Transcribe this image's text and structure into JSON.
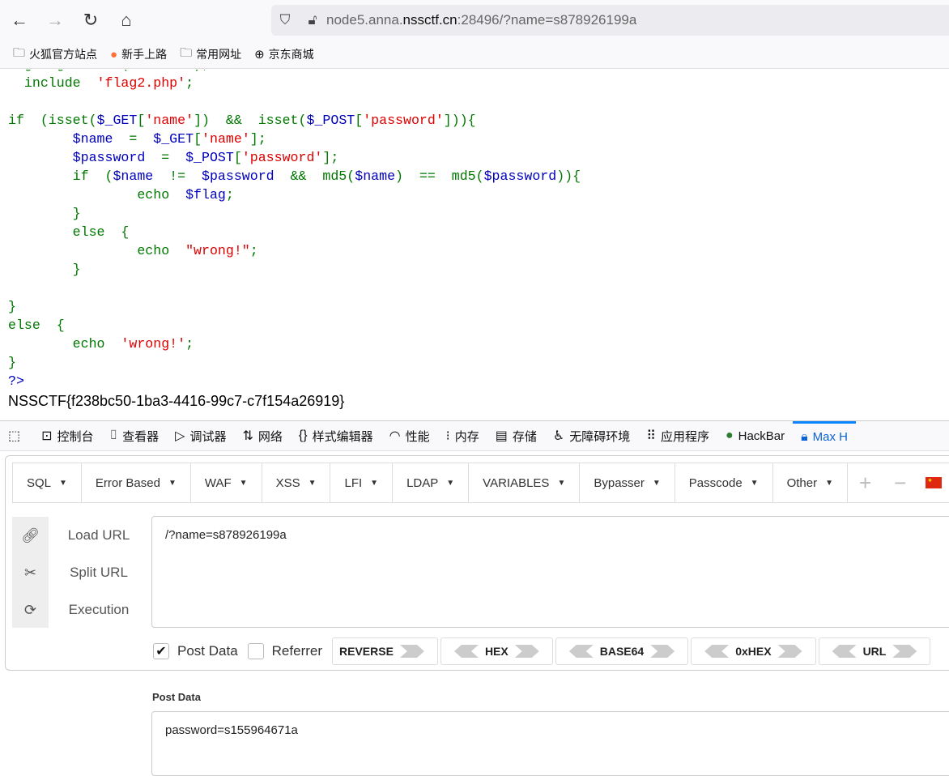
{
  "browser": {
    "url_prefix": "node5.anna.",
    "url_domain": "nssctf.cn",
    "url_suffix": ":28496/?name=s878926199a",
    "bookmarks": [
      {
        "label": "火狐官方站点",
        "icon": "folder-icon"
      },
      {
        "label": "新手上路",
        "icon": "firefox-icon"
      },
      {
        "label": "常用网址",
        "icon": "folder-icon"
      },
      {
        "label": "京东商城",
        "icon": "globe-icon"
      }
    ]
  },
  "colors": {
    "k": "#007700",
    "v": "#0000BB",
    "s": "#DD0000",
    "p": "#0000BB"
  },
  "code_lines": [
    [
      [
        "highlight_file(__FILE__);",
        "k"
      ]
    ],
    [
      [
        "  include  ",
        "k"
      ],
      [
        "'flag2.php'",
        "s"
      ],
      [
        ";",
        "k"
      ]
    ],
    [],
    [
      [
        "if  (isset(",
        "k"
      ],
      [
        "$_GET",
        "v"
      ],
      [
        "[",
        "k"
      ],
      [
        "'name'",
        "s"
      ],
      [
        "])  &&  isset(",
        "k"
      ],
      [
        "$_POST",
        "v"
      ],
      [
        "[",
        "k"
      ],
      [
        "'password'",
        "s"
      ],
      [
        "])){",
        "k"
      ]
    ],
    [
      [
        "        ",
        "k"
      ],
      [
        "$name  ",
        "v"
      ],
      [
        "=  ",
        "k"
      ],
      [
        "$_GET",
        "v"
      ],
      [
        "[",
        "k"
      ],
      [
        "'name'",
        "s"
      ],
      [
        "];",
        "k"
      ]
    ],
    [
      [
        "        ",
        "k"
      ],
      [
        "$password  ",
        "v"
      ],
      [
        "=  ",
        "k"
      ],
      [
        "$_POST",
        "v"
      ],
      [
        "[",
        "k"
      ],
      [
        "'password'",
        "s"
      ],
      [
        "];",
        "k"
      ]
    ],
    [
      [
        "        if  (",
        "k"
      ],
      [
        "$name  ",
        "v"
      ],
      [
        "!=  ",
        "k"
      ],
      [
        "$password  ",
        "v"
      ],
      [
        "&&  md5(",
        "k"
      ],
      [
        "$name",
        "v"
      ],
      [
        ")  ==  md5(",
        "k"
      ],
      [
        "$password",
        "v"
      ],
      [
        ")){",
        "k"
      ]
    ],
    [
      [
        "                echo  ",
        "k"
      ],
      [
        "$flag",
        "v"
      ],
      [
        ";",
        "k"
      ]
    ],
    [
      [
        "        }",
        "k"
      ]
    ],
    [
      [
        "        else  {",
        "k"
      ]
    ],
    [
      [
        "                echo  ",
        "k"
      ],
      [
        "\"wrong!\"",
        "s"
      ],
      [
        ";",
        "k"
      ]
    ],
    [
      [
        "        }",
        "k"
      ]
    ],
    [],
    [
      [
        "}",
        "k"
      ]
    ],
    [
      [
        "else  {",
        "k"
      ]
    ],
    [
      [
        "        echo  ",
        "k"
      ],
      [
        "'wrong!'",
        "s"
      ],
      [
        ";",
        "k"
      ]
    ],
    [
      [
        "}",
        "k"
      ]
    ],
    [
      [
        "?>",
        "p"
      ]
    ]
  ],
  "flag_output": "NSSCTF{f238bc50-1ba3-4416-99c7-c7f154a26919}",
  "devtools": {
    "tabs": [
      {
        "label": "控制台",
        "icon": "console-icon"
      },
      {
        "label": "查看器",
        "icon": "inspector-icon"
      },
      {
        "label": "调试器",
        "icon": "debugger-icon"
      },
      {
        "label": "网络",
        "icon": "network-icon"
      },
      {
        "label": "样式编辑器",
        "icon": "style-editor-icon"
      },
      {
        "label": "性能",
        "icon": "performance-icon"
      },
      {
        "label": "内存",
        "icon": "memory-icon"
      },
      {
        "label": "存储",
        "icon": "storage-icon"
      },
      {
        "label": "无障碍环境",
        "icon": "accessibility-icon"
      },
      {
        "label": "应用程序",
        "icon": "application-icon"
      },
      {
        "label": "HackBar",
        "icon": "hackbar-icon"
      },
      {
        "label": "Max H",
        "icon": "lock-icon",
        "active": true
      }
    ]
  },
  "hackbar": {
    "menu": [
      "SQL",
      "Error Based",
      "WAF",
      "XSS",
      "LFI",
      "LDAP",
      "VARIABLES",
      "Bypasser",
      "Passcode",
      "Other"
    ],
    "actions": [
      {
        "label": "Load URL",
        "icon": "link-icon"
      },
      {
        "label": "Split URL",
        "icon": "scissors-icon"
      },
      {
        "label": "Execution",
        "icon": "refresh-icon"
      }
    ],
    "url_value": "/?name=s878926199a",
    "post_data_label": "Post Data",
    "post_data_checked": true,
    "referrer_label": "Referrer",
    "referrer_checked": false,
    "encoders": [
      "REVERSE",
      "HEX",
      "BASE64",
      "0xHEX",
      "URL"
    ],
    "post_section_label": "Post Data",
    "post_value": "password=s155964671a"
  }
}
